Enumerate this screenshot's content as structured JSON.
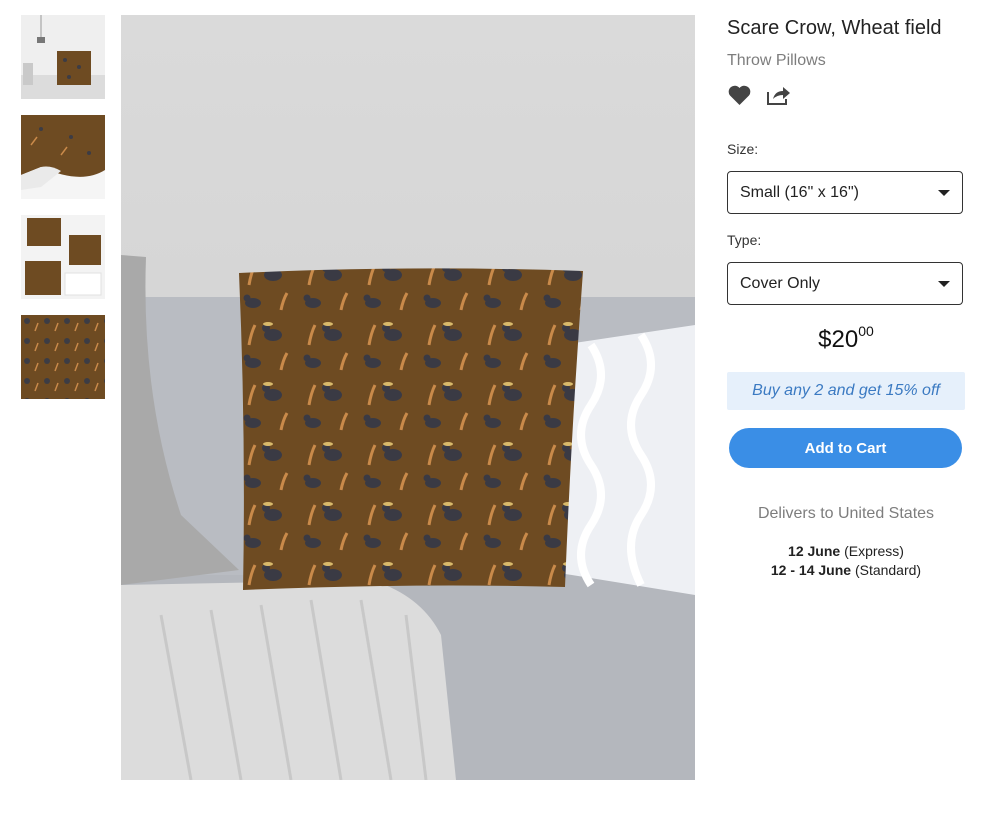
{
  "product": {
    "title": "Scare Crow, Wheat field",
    "category": "Throw Pillows",
    "favorite_icon": "heart-icon",
    "share_icon": "share-icon"
  },
  "gallery": {
    "thumbnails": [
      {
        "name": "thumbnail-room"
      },
      {
        "name": "thumbnail-pillow-side"
      },
      {
        "name": "thumbnail-pillows-floor"
      },
      {
        "name": "thumbnail-pattern"
      }
    ]
  },
  "options": {
    "size_label": "Size:",
    "size_value": "Small (16\" x 16\")",
    "type_label": "Type:",
    "type_value": "Cover Only"
  },
  "price": {
    "currency": "$",
    "whole": "20",
    "cents": "00"
  },
  "promo": "Buy any 2 and get 15% off",
  "cart_label": "Add to Cart",
  "delivery": {
    "heading": "Delivers to United States",
    "express_date": "12 June",
    "express_label": "(Express)",
    "standard_date": "12 - 14 June",
    "standard_label": "(Standard)"
  },
  "colors": {
    "accent": "#3a8ee6",
    "promo_bg": "#e6f0fb",
    "pillow_brown": "#6e4b22"
  }
}
